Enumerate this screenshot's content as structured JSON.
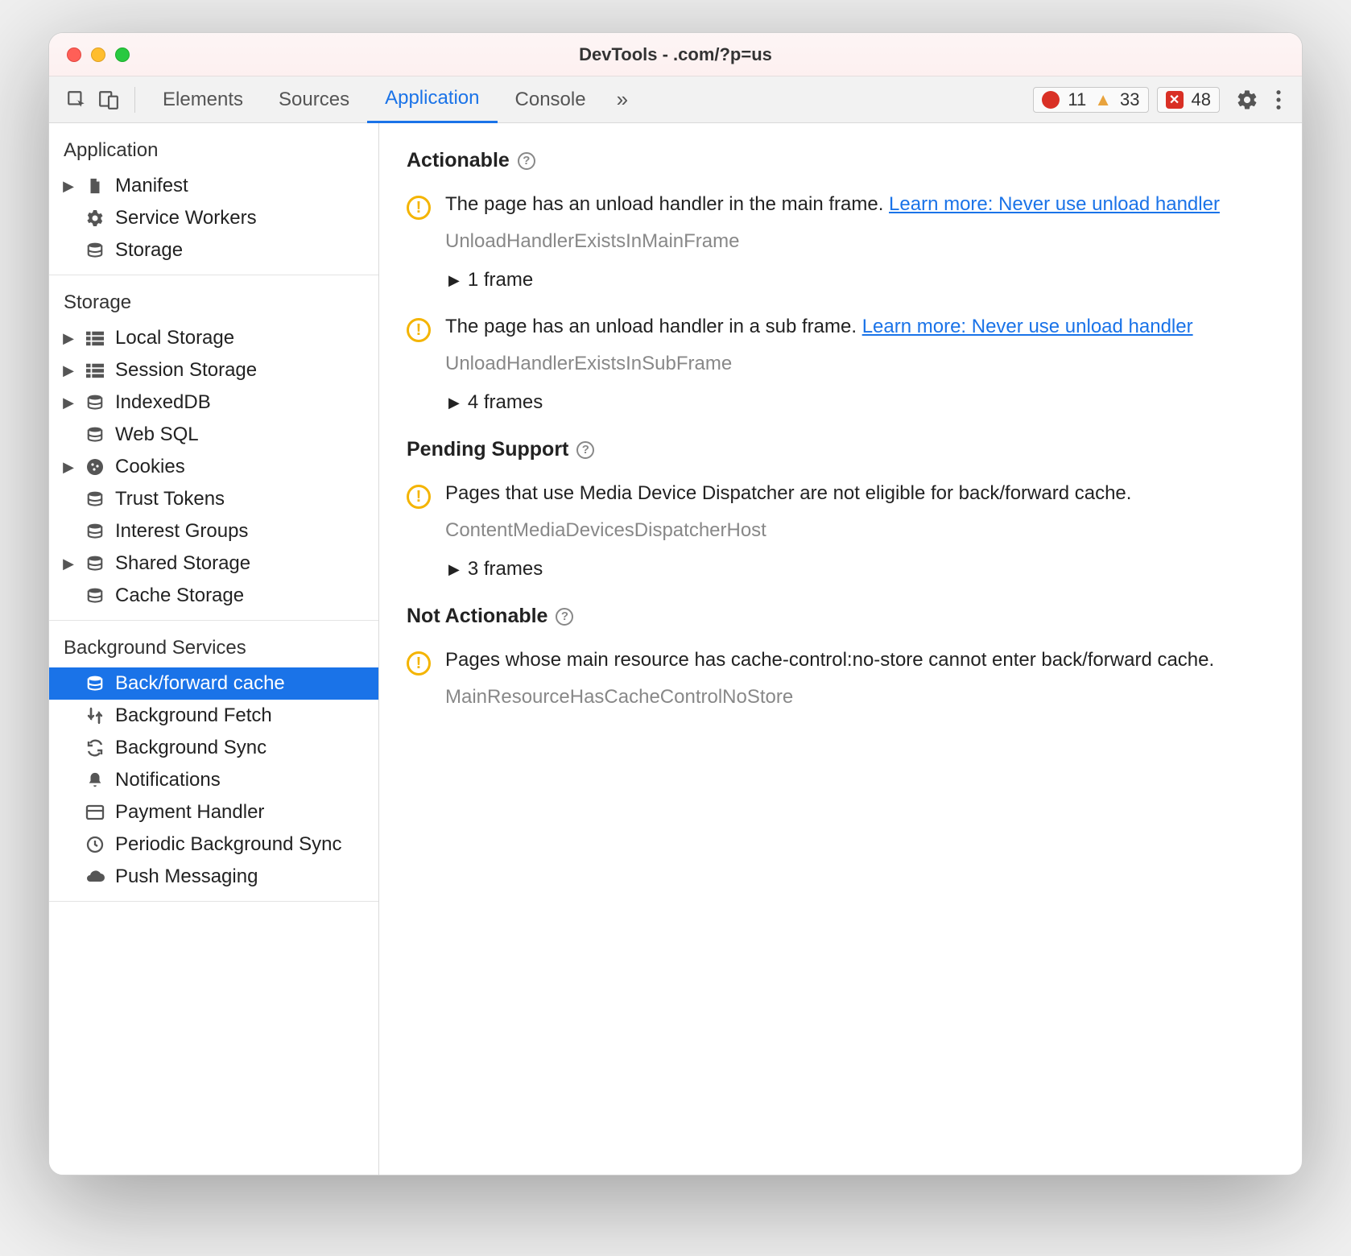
{
  "titlebar": {
    "title": "DevTools -            .com/?p=us"
  },
  "toolbar": {
    "tabs": [
      {
        "label": "Elements",
        "active": false
      },
      {
        "label": "Sources",
        "active": false
      },
      {
        "label": "Application",
        "active": true
      },
      {
        "label": "Console",
        "active": false
      }
    ],
    "errors": "11",
    "warnings": "33",
    "messages": "48"
  },
  "sidebar": {
    "sections": [
      {
        "heading": "Application",
        "items": [
          {
            "caret": true,
            "icon": "file-icon",
            "label": "Manifest"
          },
          {
            "caret": false,
            "icon": "gear-icon",
            "label": "Service Workers"
          },
          {
            "caret": false,
            "icon": "storage-icon",
            "label": "Storage"
          }
        ]
      },
      {
        "heading": "Storage",
        "items": [
          {
            "caret": true,
            "icon": "grid-icon",
            "label": "Local Storage"
          },
          {
            "caret": true,
            "icon": "grid-icon",
            "label": "Session Storage"
          },
          {
            "caret": true,
            "icon": "storage-icon",
            "label": "IndexedDB"
          },
          {
            "caret": false,
            "icon": "storage-icon",
            "label": "Web SQL"
          },
          {
            "caret": true,
            "icon": "cookie-icon",
            "label": "Cookies"
          },
          {
            "caret": false,
            "icon": "storage-icon",
            "label": "Trust Tokens"
          },
          {
            "caret": false,
            "icon": "storage-icon",
            "label": "Interest Groups"
          },
          {
            "caret": true,
            "icon": "storage-icon",
            "label": "Shared Storage"
          },
          {
            "caret": false,
            "icon": "storage-icon",
            "label": "Cache Storage"
          }
        ]
      },
      {
        "heading": "Background Services",
        "items": [
          {
            "caret": false,
            "icon": "storage-icon",
            "label": "Back/forward cache",
            "selected": true
          },
          {
            "caret": false,
            "icon": "fetch-icon",
            "label": "Background Fetch"
          },
          {
            "caret": false,
            "icon": "sync-icon",
            "label": "Background Sync"
          },
          {
            "caret": false,
            "icon": "bell-icon",
            "label": "Notifications"
          },
          {
            "caret": false,
            "icon": "card-icon",
            "label": "Payment Handler"
          },
          {
            "caret": false,
            "icon": "clock-icon",
            "label": "Periodic Background Sync"
          },
          {
            "caret": false,
            "icon": "cloud-icon",
            "label": "Push Messaging"
          }
        ]
      }
    ]
  },
  "content": {
    "sections": [
      {
        "heading": "Actionable",
        "issues": [
          {
            "text": "The page has an unload handler in the main frame. ",
            "link": "Learn more: Never use unload handler",
            "code": "UnloadHandlerExistsInMainFrame",
            "frames": "1 frame"
          },
          {
            "text": "The page has an unload handler in a sub frame. ",
            "link": "Learn more: Never use unload handler",
            "code": "UnloadHandlerExistsInSubFrame",
            "frames": "4 frames"
          }
        ]
      },
      {
        "heading": "Pending Support",
        "issues": [
          {
            "text": "Pages that use Media Device Dispatcher are not eligible for back/forward cache.",
            "link": "",
            "code": "ContentMediaDevicesDispatcherHost",
            "frames": "3 frames"
          }
        ]
      },
      {
        "heading": "Not Actionable",
        "issues": [
          {
            "text": "Pages whose main resource has cache-control:no-store cannot enter back/forward cache.",
            "link": "",
            "code": "MainResourceHasCacheControlNoStore",
            "frames": ""
          }
        ]
      }
    ]
  }
}
